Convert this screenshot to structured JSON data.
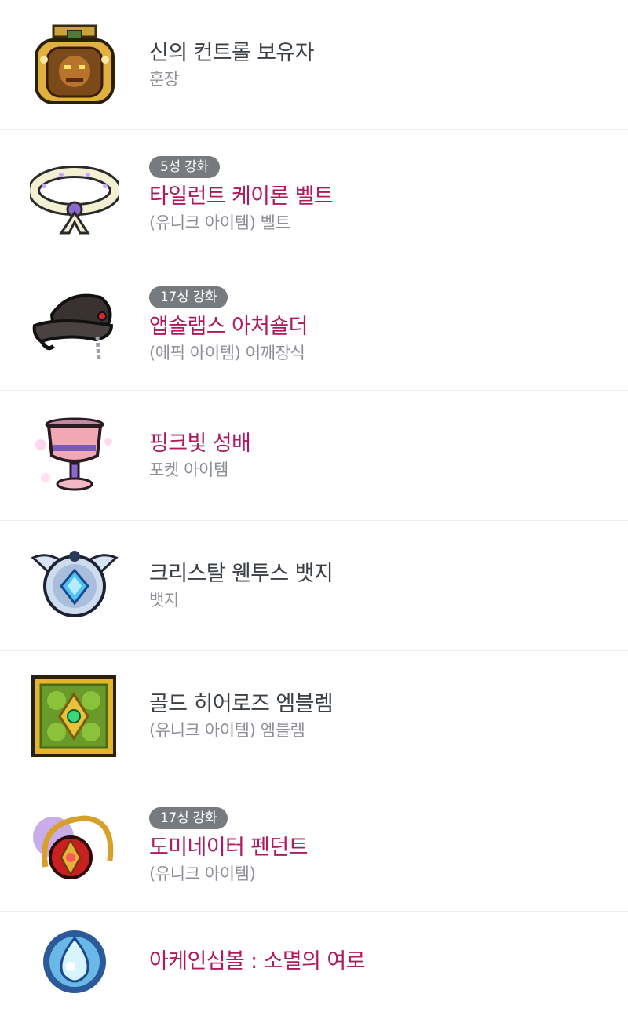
{
  "items": [
    {
      "name": "신의 컨트롤 보유자",
      "sub": "훈장",
      "badge": "",
      "highlight": false,
      "icon": "medal-icon"
    },
    {
      "name": "타일런트 케이론 벨트",
      "sub": "(유니크 아이템) 벨트",
      "badge": "5성 강화",
      "highlight": true,
      "icon": "belt-icon"
    },
    {
      "name": "앱솔랩스 아처숄더",
      "sub": "(에픽 아이템) 어깨장식",
      "badge": "17성 강화",
      "highlight": true,
      "icon": "shoulder-icon"
    },
    {
      "name": "핑크빛 성배",
      "sub": "포켓 아이템",
      "badge": "",
      "highlight": true,
      "icon": "chalice-icon"
    },
    {
      "name": "크리스탈 웬투스 뱃지",
      "sub": "뱃지",
      "badge": "",
      "highlight": false,
      "icon": "badge-icon"
    },
    {
      "name": "골드 히어로즈 엠블렘",
      "sub": "(유니크 아이템) 엠블렘",
      "badge": "",
      "highlight": false,
      "icon": "emblem-icon"
    },
    {
      "name": "도미네이터 펜던트",
      "sub": "(유니크 아이템)",
      "badge": "17성 강화",
      "highlight": true,
      "icon": "pendant-icon"
    },
    {
      "name": "아케인심볼 : 소멸의 여로",
      "sub": "",
      "badge": "",
      "highlight": true,
      "icon": "arcane-symbol-icon"
    }
  ],
  "colors": {
    "highlight_text": "#b0195e",
    "normal_text": "#3b4047",
    "sub_text": "#8c9096",
    "badge_bg": "#777b7f"
  }
}
